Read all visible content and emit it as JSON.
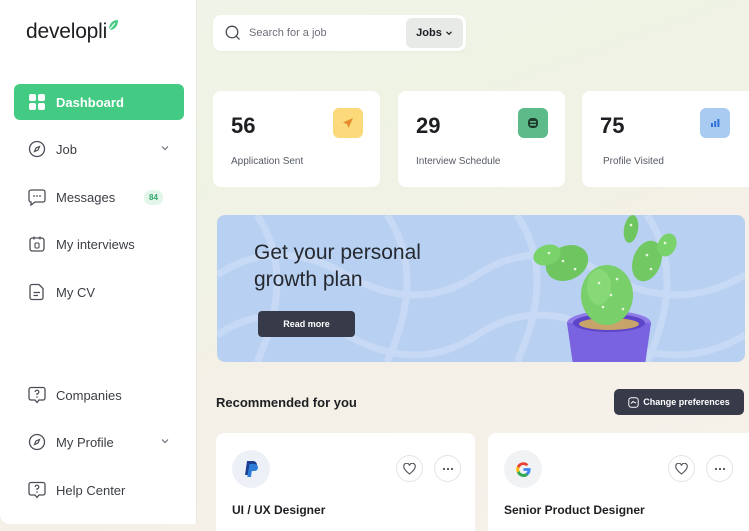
{
  "brand": {
    "name": "developli",
    "accent": "#43cb83"
  },
  "sidebar": {
    "items": [
      {
        "label": "Dashboard",
        "icon": "grid-icon",
        "active": true
      },
      {
        "label": "Job",
        "icon": "compass-icon",
        "expandable": true
      },
      {
        "label": "Messages",
        "icon": "message-icon",
        "badge": "84"
      },
      {
        "label": "My interviews",
        "icon": "calendar-icon"
      },
      {
        "label": "My CV",
        "icon": "document-icon"
      },
      {
        "label": "Companies",
        "icon": "help-bubble-icon"
      },
      {
        "label": "My Profile",
        "icon": "compass-icon",
        "expandable": true
      },
      {
        "label": "Help Center",
        "icon": "help-bubble-icon"
      }
    ]
  },
  "search": {
    "placeholder": "Search for a job",
    "filter_label": "Jobs"
  },
  "stats": [
    {
      "value": "56",
      "label": "Application Sent",
      "icon": "send-icon",
      "color": "#fcd97a"
    },
    {
      "value": "29",
      "label": "Interview Schedule",
      "icon": "chat-icon",
      "color": "#5dbb8a"
    },
    {
      "value": "75",
      "label": "Profile Visited",
      "icon": "bar-chart-icon",
      "color": "#a9cbf2"
    }
  ],
  "banner": {
    "title": "Get your personal growth plan",
    "button_label": "Read more"
  },
  "recommended": {
    "title": "Recommended for you",
    "change_label": "Change preferences",
    "jobs": [
      {
        "title": "UI / UX Designer",
        "company_icon": "paypal-icon"
      },
      {
        "title": "Senior Product Designer",
        "company_icon": "google-icon"
      }
    ]
  }
}
